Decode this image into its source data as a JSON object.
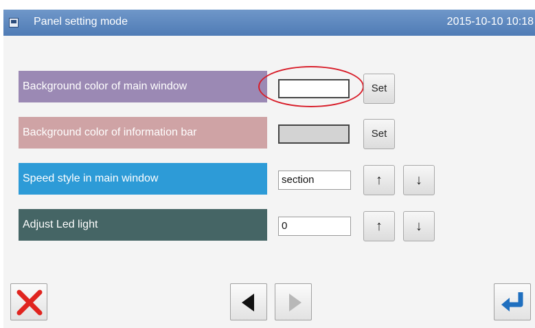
{
  "titlebar": {
    "title": "Panel setting mode",
    "datetime": "2015-10-10 10:18",
    "icon": "panel-icon"
  },
  "settings": {
    "main_window_bg": {
      "label": "Background color of main window",
      "label_color": "#9b89b4",
      "swatch_color": "#ffffff",
      "button_label": "Set"
    },
    "info_bar_bg": {
      "label": "Background color of information bar",
      "label_color": "#cfa3a5",
      "swatch_color": "#d3d3d3",
      "button_label": "Set"
    },
    "speed_style": {
      "label": "Speed style in main window",
      "label_color": "#2d9bd7",
      "value": "section",
      "up_label": "↑",
      "down_label": "↓"
    },
    "led_light": {
      "label": "Adjust Led light",
      "label_color": "#456565",
      "value": "0",
      "up_label": "↑",
      "down_label": "↓"
    }
  },
  "footer": {
    "cancel_icon": "close-x-icon",
    "prev_icon": "triangle-left-icon",
    "next_icon": "triangle-right-icon",
    "enter_icon": "return-arrow-icon"
  },
  "colors": {
    "highlight": "#d81e2a",
    "titlebar": "#5b86bf"
  }
}
